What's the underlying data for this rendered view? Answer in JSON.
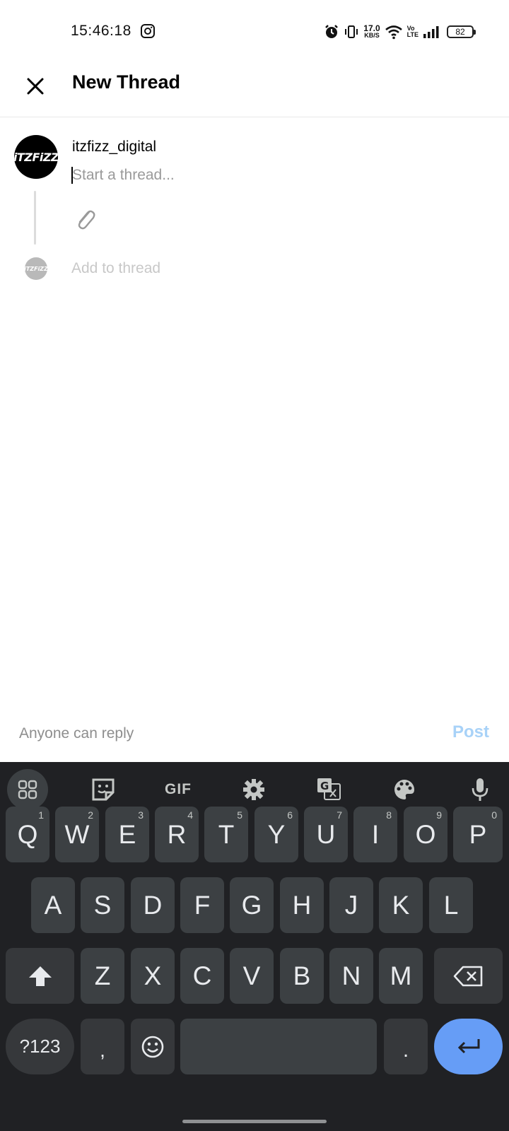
{
  "status_bar": {
    "time": "15:46:18",
    "net_speed_value": "17.0",
    "net_speed_unit": "KB/S",
    "volte_top": "Vo",
    "volte_bottom": "LTE",
    "battery": "82"
  },
  "header": {
    "title": "New Thread",
    "close_icon": "close-icon"
  },
  "composer": {
    "avatar_text": "iTZFiZZ",
    "username": "itzfizz_digital",
    "placeholder": "Start a thread...",
    "attach_icon": "paperclip-icon",
    "add_to_thread": "Add to thread"
  },
  "footer": {
    "reply_setting": "Anyone can reply",
    "post_label": "Post",
    "post_color": "#a8d2f8"
  },
  "keyboard": {
    "toolbar": [
      "apps-grid-icon",
      "sticker-icon",
      "GIF",
      "gear-icon",
      "translate-icon",
      "palette-icon",
      "mic-icon"
    ],
    "row1": [
      {
        "key": "Q",
        "hint": "1"
      },
      {
        "key": "W",
        "hint": "2"
      },
      {
        "key": "E",
        "hint": "3"
      },
      {
        "key": "R",
        "hint": "4"
      },
      {
        "key": "T",
        "hint": "5"
      },
      {
        "key": "Y",
        "hint": "6"
      },
      {
        "key": "U",
        "hint": "7"
      },
      {
        "key": "I",
        "hint": "8"
      },
      {
        "key": "O",
        "hint": "9"
      },
      {
        "key": "P",
        "hint": "0"
      }
    ],
    "row2": [
      "A",
      "S",
      "D",
      "F",
      "G",
      "H",
      "J",
      "K",
      "L"
    ],
    "row3": [
      "Z",
      "X",
      "C",
      "V",
      "B",
      "N",
      "M"
    ],
    "symbols_label": "?123",
    "comma": ",",
    "period": ".",
    "enter_color": "#669df6"
  }
}
